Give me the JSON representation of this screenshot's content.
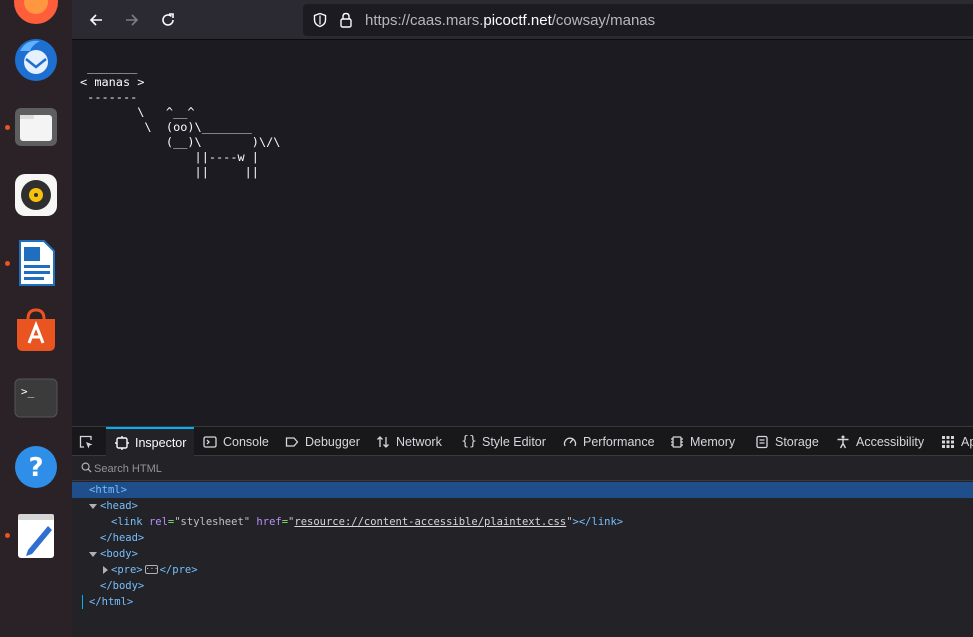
{
  "browser": {
    "url_prefix": "https://caas.mars.",
    "url_domain": "picoctf.net",
    "url_path": "/cowsay/manas"
  },
  "page": {
    "cowsay_output": " _______\n< manas >\n -------\n        \\   ^__^\n         \\  (oo)\\_______\n            (__)\\       )\\/\\\n                ||----w |\n                ||     ||"
  },
  "devtools": {
    "tabs": [
      {
        "label": "Inspector",
        "icon": "inspector-icon"
      },
      {
        "label": "Console",
        "icon": "console-icon"
      },
      {
        "label": "Debugger",
        "icon": "debugger-icon"
      },
      {
        "label": "Network",
        "icon": "network-icon"
      },
      {
        "label": "Style Editor",
        "icon": "style-editor-icon"
      },
      {
        "label": "Performance",
        "icon": "performance-icon"
      },
      {
        "label": "Memory",
        "icon": "memory-icon"
      },
      {
        "label": "Storage",
        "icon": "storage-icon"
      },
      {
        "label": "Accessibility",
        "icon": "accessibility-icon"
      },
      {
        "label": "Ap",
        "icon": "application-icon"
      }
    ],
    "search_placeholder": "Search HTML",
    "tree": {
      "html_open": "<html>",
      "head_open": "<head>",
      "link_tag_open": "<link",
      "link_rel_name": "rel",
      "link_rel_value": "\"stylesheet\"",
      "link_href_name": "href",
      "link_href_value": "resource://content-accessible/plaintext.css",
      "link_close": "></link>",
      "head_close": "</head>",
      "body_open": "<body>",
      "pre_open": "<pre>",
      "pre_ellipsis": "···",
      "pre_close": "</pre>",
      "body_close": "</body>",
      "html_close": "</html>"
    }
  },
  "colors": {
    "accent": "#00b3f4",
    "selection": "#204e8a",
    "tag": "#75bfff",
    "attr_name": "#b98eff"
  }
}
